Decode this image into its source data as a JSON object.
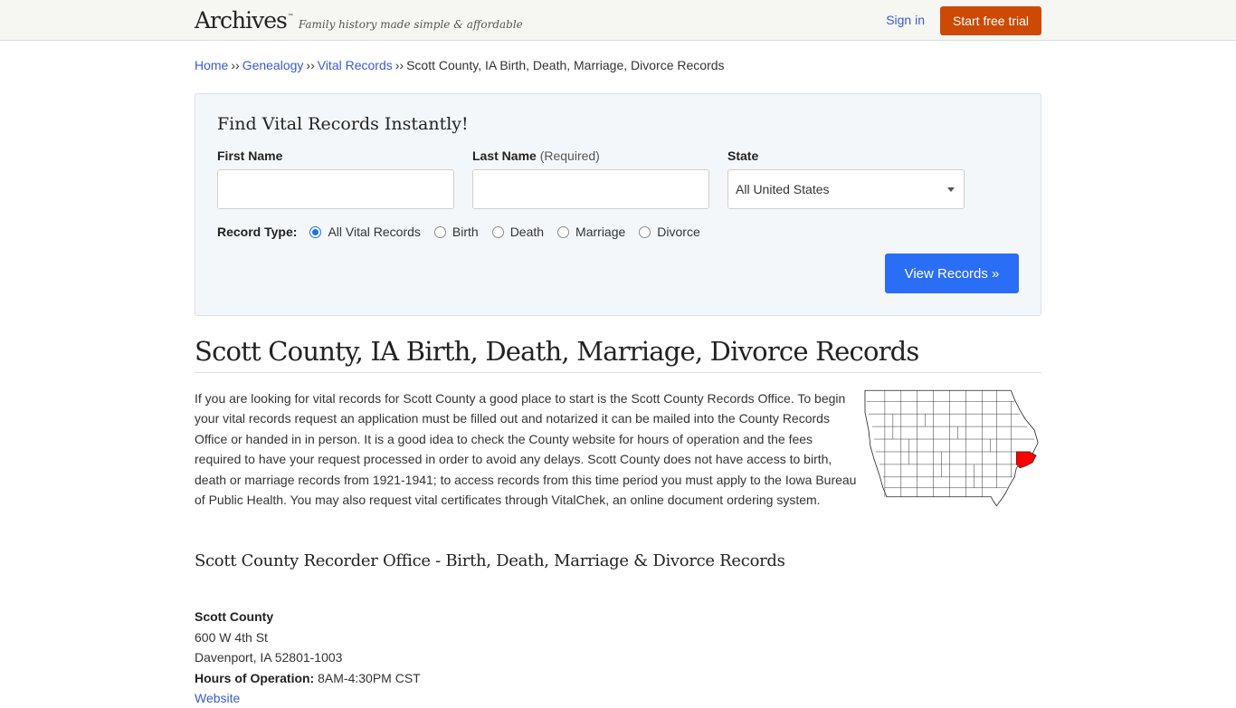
{
  "header": {
    "logo": "Archives",
    "logo_tm": "™",
    "tagline": "Family history made simple & affordable",
    "signin": "Sign in",
    "trial": "Start free trial"
  },
  "breadcrumb": {
    "items": [
      "Home",
      "Genealogy",
      "Vital Records"
    ],
    "separator": "››",
    "current": "Scott County, IA Birth, Death, Marriage, Divorce Records"
  },
  "search": {
    "title": "Find Vital Records Instantly!",
    "first_name_label": "First Name",
    "first_name_value": "",
    "last_name_label": "Last Name",
    "last_name_required": "(Required)",
    "last_name_value": "",
    "state_label": "State",
    "state_value": "All United States",
    "record_type_label": "Record Type:",
    "record_types": [
      "All Vital Records",
      "Birth",
      "Death",
      "Marriage",
      "Divorce"
    ],
    "record_type_selected": "All Vital Records",
    "submit": "View Records »"
  },
  "main": {
    "title": "Scott County, IA Birth, Death, Marriage, Divorce Records",
    "intro": "If you are looking for vital records for Scott County a good place to start is the Scott County Records Office. To begin your vital records request an application must be filled out and notarized it can be mailed into the County Records Office or handed in in person. It is a good idea to check the County website for hours of operation and the fees required to have your request processed in order to avoid any delays. Scott County does not have access to birth, death or marriage records from 1921-1941; to access records from this time period you must apply to the Iowa Bureau of Public Health. You may also request vital certificates through VitalChek, an online document ordering system.",
    "map": {
      "state": "Iowa",
      "highlighted_county": "Scott County",
      "highlight_color": "#ff0000"
    },
    "section_title": "Scott County Recorder Office - Birth, Death, Marriage & Divorce Records",
    "office": {
      "name": "Scott County",
      "address1": "600 W 4th St",
      "address2": "Davenport, IA 52801-1003",
      "hours_label": "Hours of Operation:",
      "hours": "8AM-4:30PM CST",
      "website": "Website"
    }
  },
  "colors": {
    "link": "#3a5bd9",
    "trial_button": "#cc4a05",
    "view_button": "#2b6ef6"
  }
}
